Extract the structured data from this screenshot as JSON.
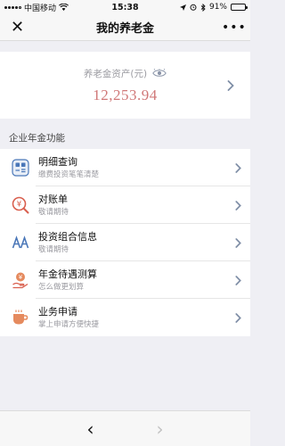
{
  "status_bar": {
    "carrier": "中国移动",
    "time": "15:38",
    "battery": "91%",
    "battery_level": 0.91
  },
  "nav": {
    "title": "我的养老金",
    "close_glyph": "✕",
    "more_glyph": "•••"
  },
  "asset": {
    "label": "养老金资产(元)",
    "value": "12,253.94",
    "icon": "eye-icon"
  },
  "section": {
    "title": "企业年金功能"
  },
  "items": [
    {
      "title": "明细查询",
      "subtitle": "缴费投资笔笔清楚",
      "icon": "detail-query-icon"
    },
    {
      "title": "对账单",
      "subtitle": "敬请期待",
      "icon": "statement-icon"
    },
    {
      "title": "投资组合信息",
      "subtitle": "敬请期待",
      "icon": "portfolio-icon"
    },
    {
      "title": "年金待遇测算",
      "subtitle": "怎么做更划算",
      "icon": "benefit-calc-icon"
    },
    {
      "title": "业务申请",
      "subtitle": "掌上申请方便快捷",
      "icon": "business-apply-icon"
    }
  ],
  "bottom_bar": {
    "back_glyph": "‹",
    "forward_glyph": "›"
  },
  "colors": {
    "accent_red": "#d07878",
    "icon_blue": "#4a77b8",
    "icon_red": "#d95f4e",
    "icon_orange": "#e58a5e",
    "chevron": "#7f8ea6"
  }
}
